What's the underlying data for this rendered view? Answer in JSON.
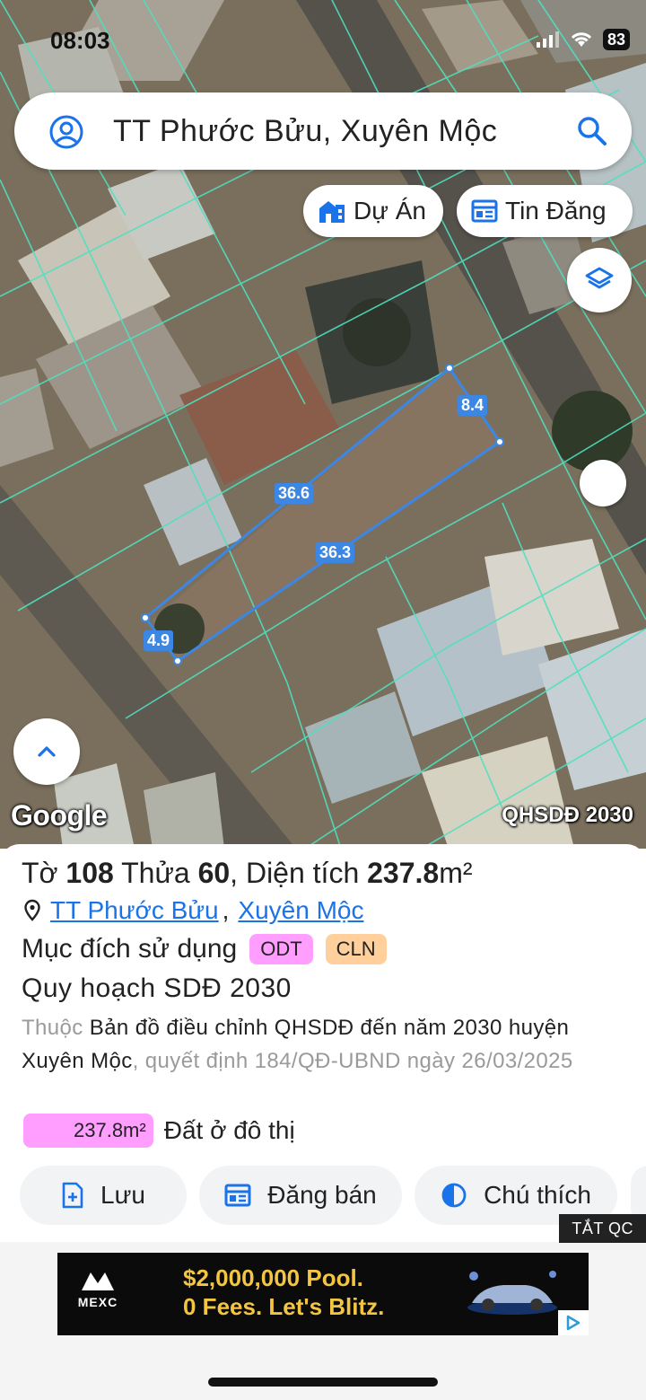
{
  "status_bar": {
    "time": "08:03",
    "battery": "83"
  },
  "search": {
    "text": "TT Phước Bửu, Xuyên Mộc"
  },
  "chips": {
    "du_an": "Dự Án",
    "tin_dang": "Tin Đăng"
  },
  "map": {
    "measurements": {
      "top_side": "8.4",
      "long_side_top": "36.6",
      "long_side_bottom": "36.3",
      "bottom_side": "4.9"
    },
    "google_label": "Google",
    "layer_label": "QHSDĐ 2030"
  },
  "parcel": {
    "title_sheet_label": "Tờ",
    "sheet": "108",
    "title_lot_label": "Thửa",
    "lot": "60",
    "title_area_label": "Diện tích",
    "area": "237.8",
    "area_unit": "m²",
    "location_1": "TT Phước Bửu",
    "location_2": "Xuyên Mộc",
    "purpose_label": "Mục đích sử dụng",
    "purpose_tags": [
      "ODT",
      "CLN"
    ],
    "plan_title": "Quy hoạch SDĐ 2030",
    "plan_prefix": "Thuộc",
    "plan_name": "Bản đồ điều chỉnh QHSDĐ đến năm 2030 huyện Xuyên Mộc",
    "plan_decision": ", quyết định 184/QĐ-UBND ngày 26/03/2025",
    "zone_area": "237.8m²",
    "zone_label": "Đất ở đô thị"
  },
  "actions": {
    "save": "Lưu",
    "post": "Đăng bán",
    "legend": "Chú thích"
  },
  "ad": {
    "close_label": "TẮT QC",
    "brand": "MEXC",
    "line1": "$2,000,000 Pool.",
    "line2": "0 Fees. Let's Blitz."
  },
  "colors": {
    "accent": "#1a73e8",
    "odt": "#ff9eff",
    "cln": "#ffd09c",
    "measure": "#3d87e4",
    "parcel_lines": "#4fe0c0"
  }
}
